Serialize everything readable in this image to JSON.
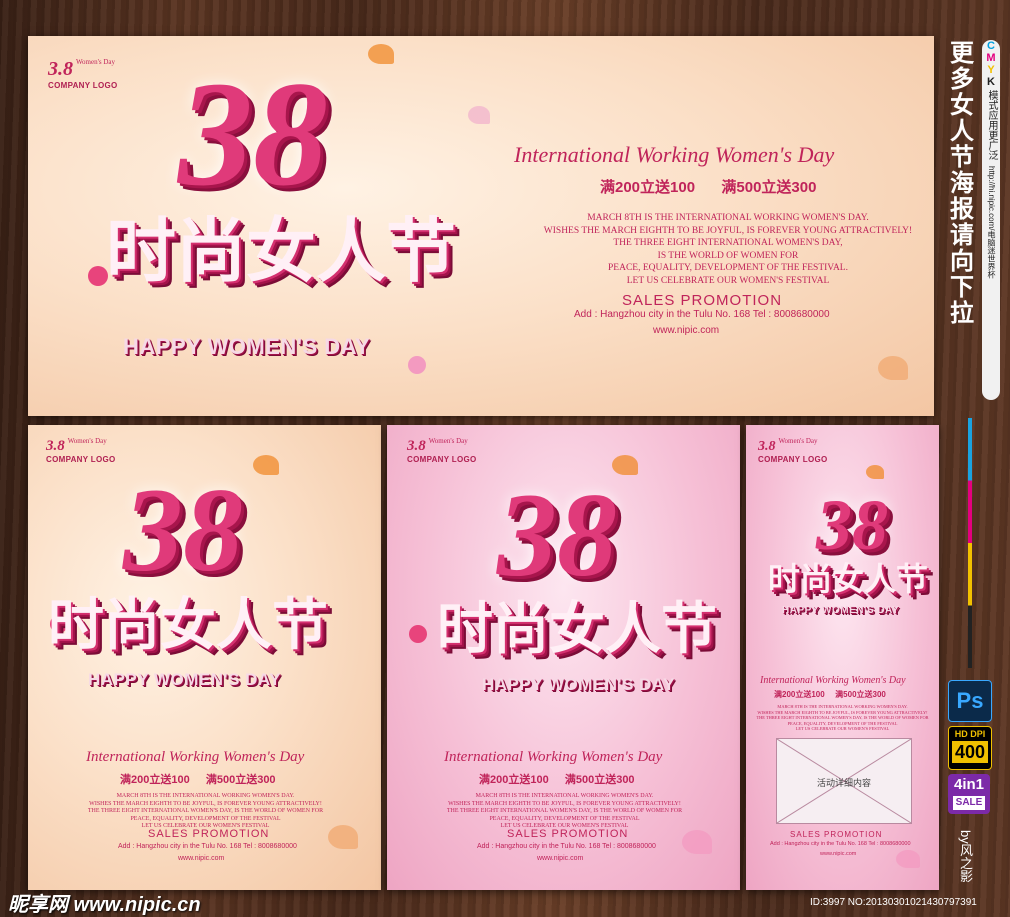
{
  "side_title": [
    "更",
    "多",
    "女",
    "人",
    "节",
    "海",
    "报",
    "请",
    "向",
    "下",
    "拉"
  ],
  "cmyk_label": "CMYK",
  "cmyk_vertical": "模式应用更广泛",
  "url_vertical": "http://hi.nipic.com/电脑迷世界杯",
  "colors": {
    "accent": "#c0245a",
    "wood": "#4a2a1b",
    "peach": "#fbe0c8",
    "pink": "#f6c0d6"
  },
  "posters": {
    "logo_num": "3.8",
    "logo_small": "Women's Day",
    "logo_company": "COMPANY LOGO",
    "big_number": "38",
    "chinese_title": "时尚女人节",
    "happy": "HAPPY WOMEN'S DAY",
    "intl": "International Working Women's Day",
    "promo_1": "满200立送100",
    "promo_2": "满500立送300",
    "body_lines": [
      "MARCH 8TH IS THE INTERNATIONAL WORKING WOMEN'S DAY.",
      "WISHES THE MARCH EIGHTH TO BE JOYFUL, IS FOREVER YOUNG ATTRACTIVELY!",
      "THE THREE EIGHT INTERNATIONAL WOMEN'S DAY,",
      "IS THE WORLD OF WOMEN FOR",
      "PEACE, EQUALITY, DEVELOPMENT OF THE FESTIVAL.",
      "LET US CELEBRATE OUR WOMEN'S FESTIVAL"
    ],
    "body_lines_small": [
      "MARCH 8TH IS THE INTERNATIONAL WORKING WOMEN'S DAY.",
      "WISHES THE MARCH EIGHTH TO BE JOYFUL, IS FOREVER YOUNG ATTRACTIVELY!",
      "THE THREE EIGHT INTERNATIONAL WOMEN'S DAY, IS THE WORLD OF WOMEN FOR",
      "PEACE, EQUALITY, DEVELOPMENT OF THE FESTIVAL",
      "LET US CELEBRATE OUR WOMEN'S FESTIVAL"
    ],
    "sales": "SALES PROMOTION",
    "address": "Add : Hangzhou city in the Tulu No. 168   Tel : 8008680000",
    "website": "www.nipic.com"
  },
  "narrow_detail_box": "活动详细内容",
  "badges": {
    "ps": "Ps",
    "hd": "HD DPI",
    "dpi": "400",
    "four": "4in1",
    "sale": "SALE"
  },
  "byline": "by风之影",
  "watermark_logo": "昵享网 www.nipic.cn",
  "footer_id": "ID:3997 NO:20130301021430797391"
}
